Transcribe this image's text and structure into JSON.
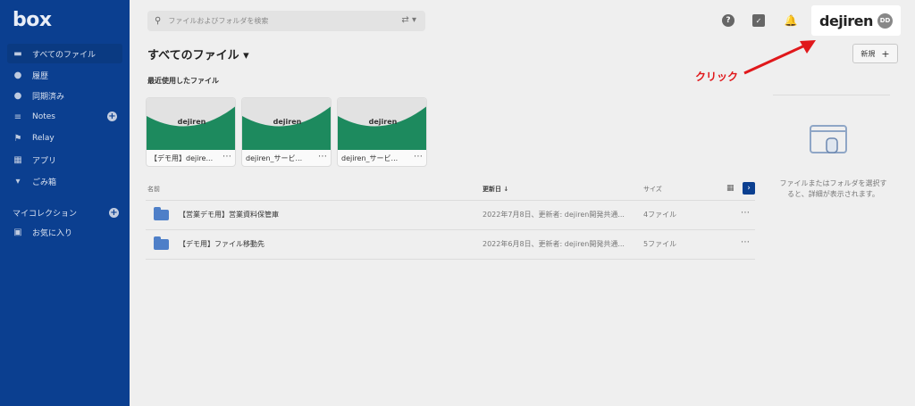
{
  "sidebar": {
    "logo": "box",
    "items": [
      {
        "label": "すべてのファイル",
        "icon": "folder-icon"
      },
      {
        "label": "履歴",
        "icon": "clock-icon"
      },
      {
        "label": "同期済み",
        "icon": "check-circle-icon"
      },
      {
        "label": "Notes",
        "icon": "notes-icon"
      },
      {
        "label": "Relay",
        "icon": "relay-icon"
      },
      {
        "label": "アプリ",
        "icon": "apps-icon"
      },
      {
        "label": "ごみ箱",
        "icon": "trash-icon"
      }
    ],
    "collections_label": "マイコレクション",
    "favorites_label": "お気に入り"
  },
  "search": {
    "placeholder": "ファイルおよびフォルダを検索"
  },
  "header": {
    "brand": "dejiren",
    "avatar_initials": "DD",
    "new_label": "新規",
    "title": "すべてのファイル ▾"
  },
  "annotation": {
    "text": "クリック",
    "color": "#e0181b"
  },
  "recent": {
    "label": "最近使用したファイル",
    "cards": [
      {
        "name": "【デモ用】dejire...",
        "thumb_logo": "dejiren"
      },
      {
        "name": "dejiren_サービ...",
        "thumb_logo": "dejiren"
      },
      {
        "name": "dejiren_サービ...",
        "thumb_logo": "dejiren"
      }
    ]
  },
  "table": {
    "headers": {
      "name": "名前",
      "modified": "更新日 ↓",
      "size": "サイズ"
    },
    "rows": [
      {
        "name": "【営業デモ用】営業資料保管庫",
        "modified": "2022年7月8日、更新者: dejiren開発共通...",
        "size": "4ファイル"
      },
      {
        "name": "【デモ用】ファイル移動先",
        "modified": "2022年6月8日、更新者: dejiren開発共通...",
        "size": "5ファイル"
      }
    ]
  },
  "details_panel": {
    "text": "ファイルまたはフォルダを選択すると、詳細が表示されます。"
  },
  "colors": {
    "sidebar": "#0b3f90",
    "accent": "#0b3f90",
    "thumb_green": "#1d8a5e"
  }
}
